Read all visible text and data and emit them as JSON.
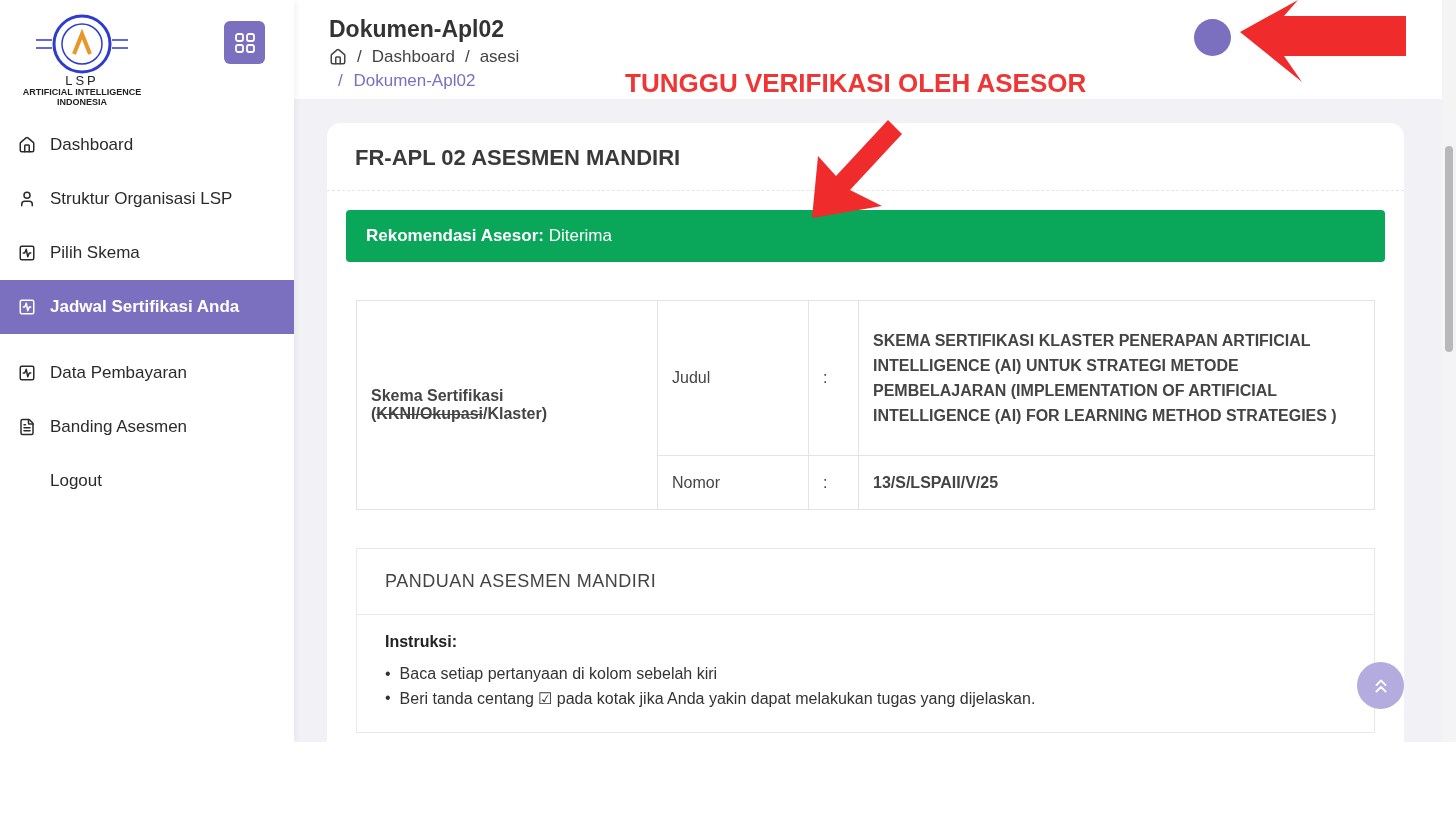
{
  "logo": {
    "title": "LSP",
    "subtitle": "ARTIFICIAL INTELLIGENCE",
    "subtitle2": "INDONESIA"
  },
  "sidebar": {
    "items": [
      {
        "label": "Dashboard",
        "kind": "home",
        "selected": false
      },
      {
        "label": "Struktur Organisasi LSP",
        "kind": "user",
        "selected": false
      },
      {
        "label": "Pilih Skema",
        "kind": "chart",
        "selected": false
      },
      {
        "label": "Jadwal Sertifikasi Anda",
        "kind": "chart",
        "selected": true
      },
      {
        "label": "Data Pembayaran",
        "kind": "chart",
        "selected": false
      },
      {
        "label": "Banding Asesmen",
        "kind": "document",
        "selected": false
      },
      {
        "label": "Logout",
        "kind": "plain",
        "selected": false
      }
    ]
  },
  "header": {
    "title": "Dokumen-Apl02",
    "breadcrumb": [
      "Dashboard",
      "asesi"
    ],
    "breadcrumb_current": "Dokumen-Apl02",
    "separator": "/",
    "annotation": "TUNGGU VERIFIKASI OLEH ASESOR"
  },
  "card": {
    "title": "FR-APL 02 ASESMEN MANDIRI",
    "recommendation": {
      "label": "Rekomendasi Asesor:",
      "value": "Diterima"
    },
    "scheme": {
      "label_parts": [
        {
          "text": "Skema Sertifikasi (",
          "struck": false
        },
        {
          "text": "KKNI/Okupasi",
          "struck": true
        },
        {
          "text": "/Klaster)",
          "struck": false
        }
      ],
      "rows": [
        {
          "field": "Judul",
          "colon": ":",
          "value": "SKEMA SERTIFIKASI KLASTER PENERAPAN ARTIFICIAL INTELLIGENCE (AI) UNTUK STRATEGI METODE PEMBELAJARAN (IMPLEMENTATION OF ARTIFICIAL INTELLIGENCE (AI) FOR LEARNING METHOD STRATEGIES )"
        },
        {
          "field": "Nomor",
          "colon": ":",
          "value": "13/S/LSPAII/V/25"
        }
      ]
    },
    "guide": {
      "title": "PANDUAN ASESMEN MANDIRI",
      "instructions_label": "Instruksi:",
      "instructions": [
        {
          "marker": "•",
          "text": "Baca setiap pertanyaan di kolom sebelah kiri"
        },
        {
          "marker": "•",
          "text": "Beri tanda centang ☑ pada kotak jika Anda yakin dapat melakukan tugas yang dijelaskan."
        }
      ]
    }
  }
}
